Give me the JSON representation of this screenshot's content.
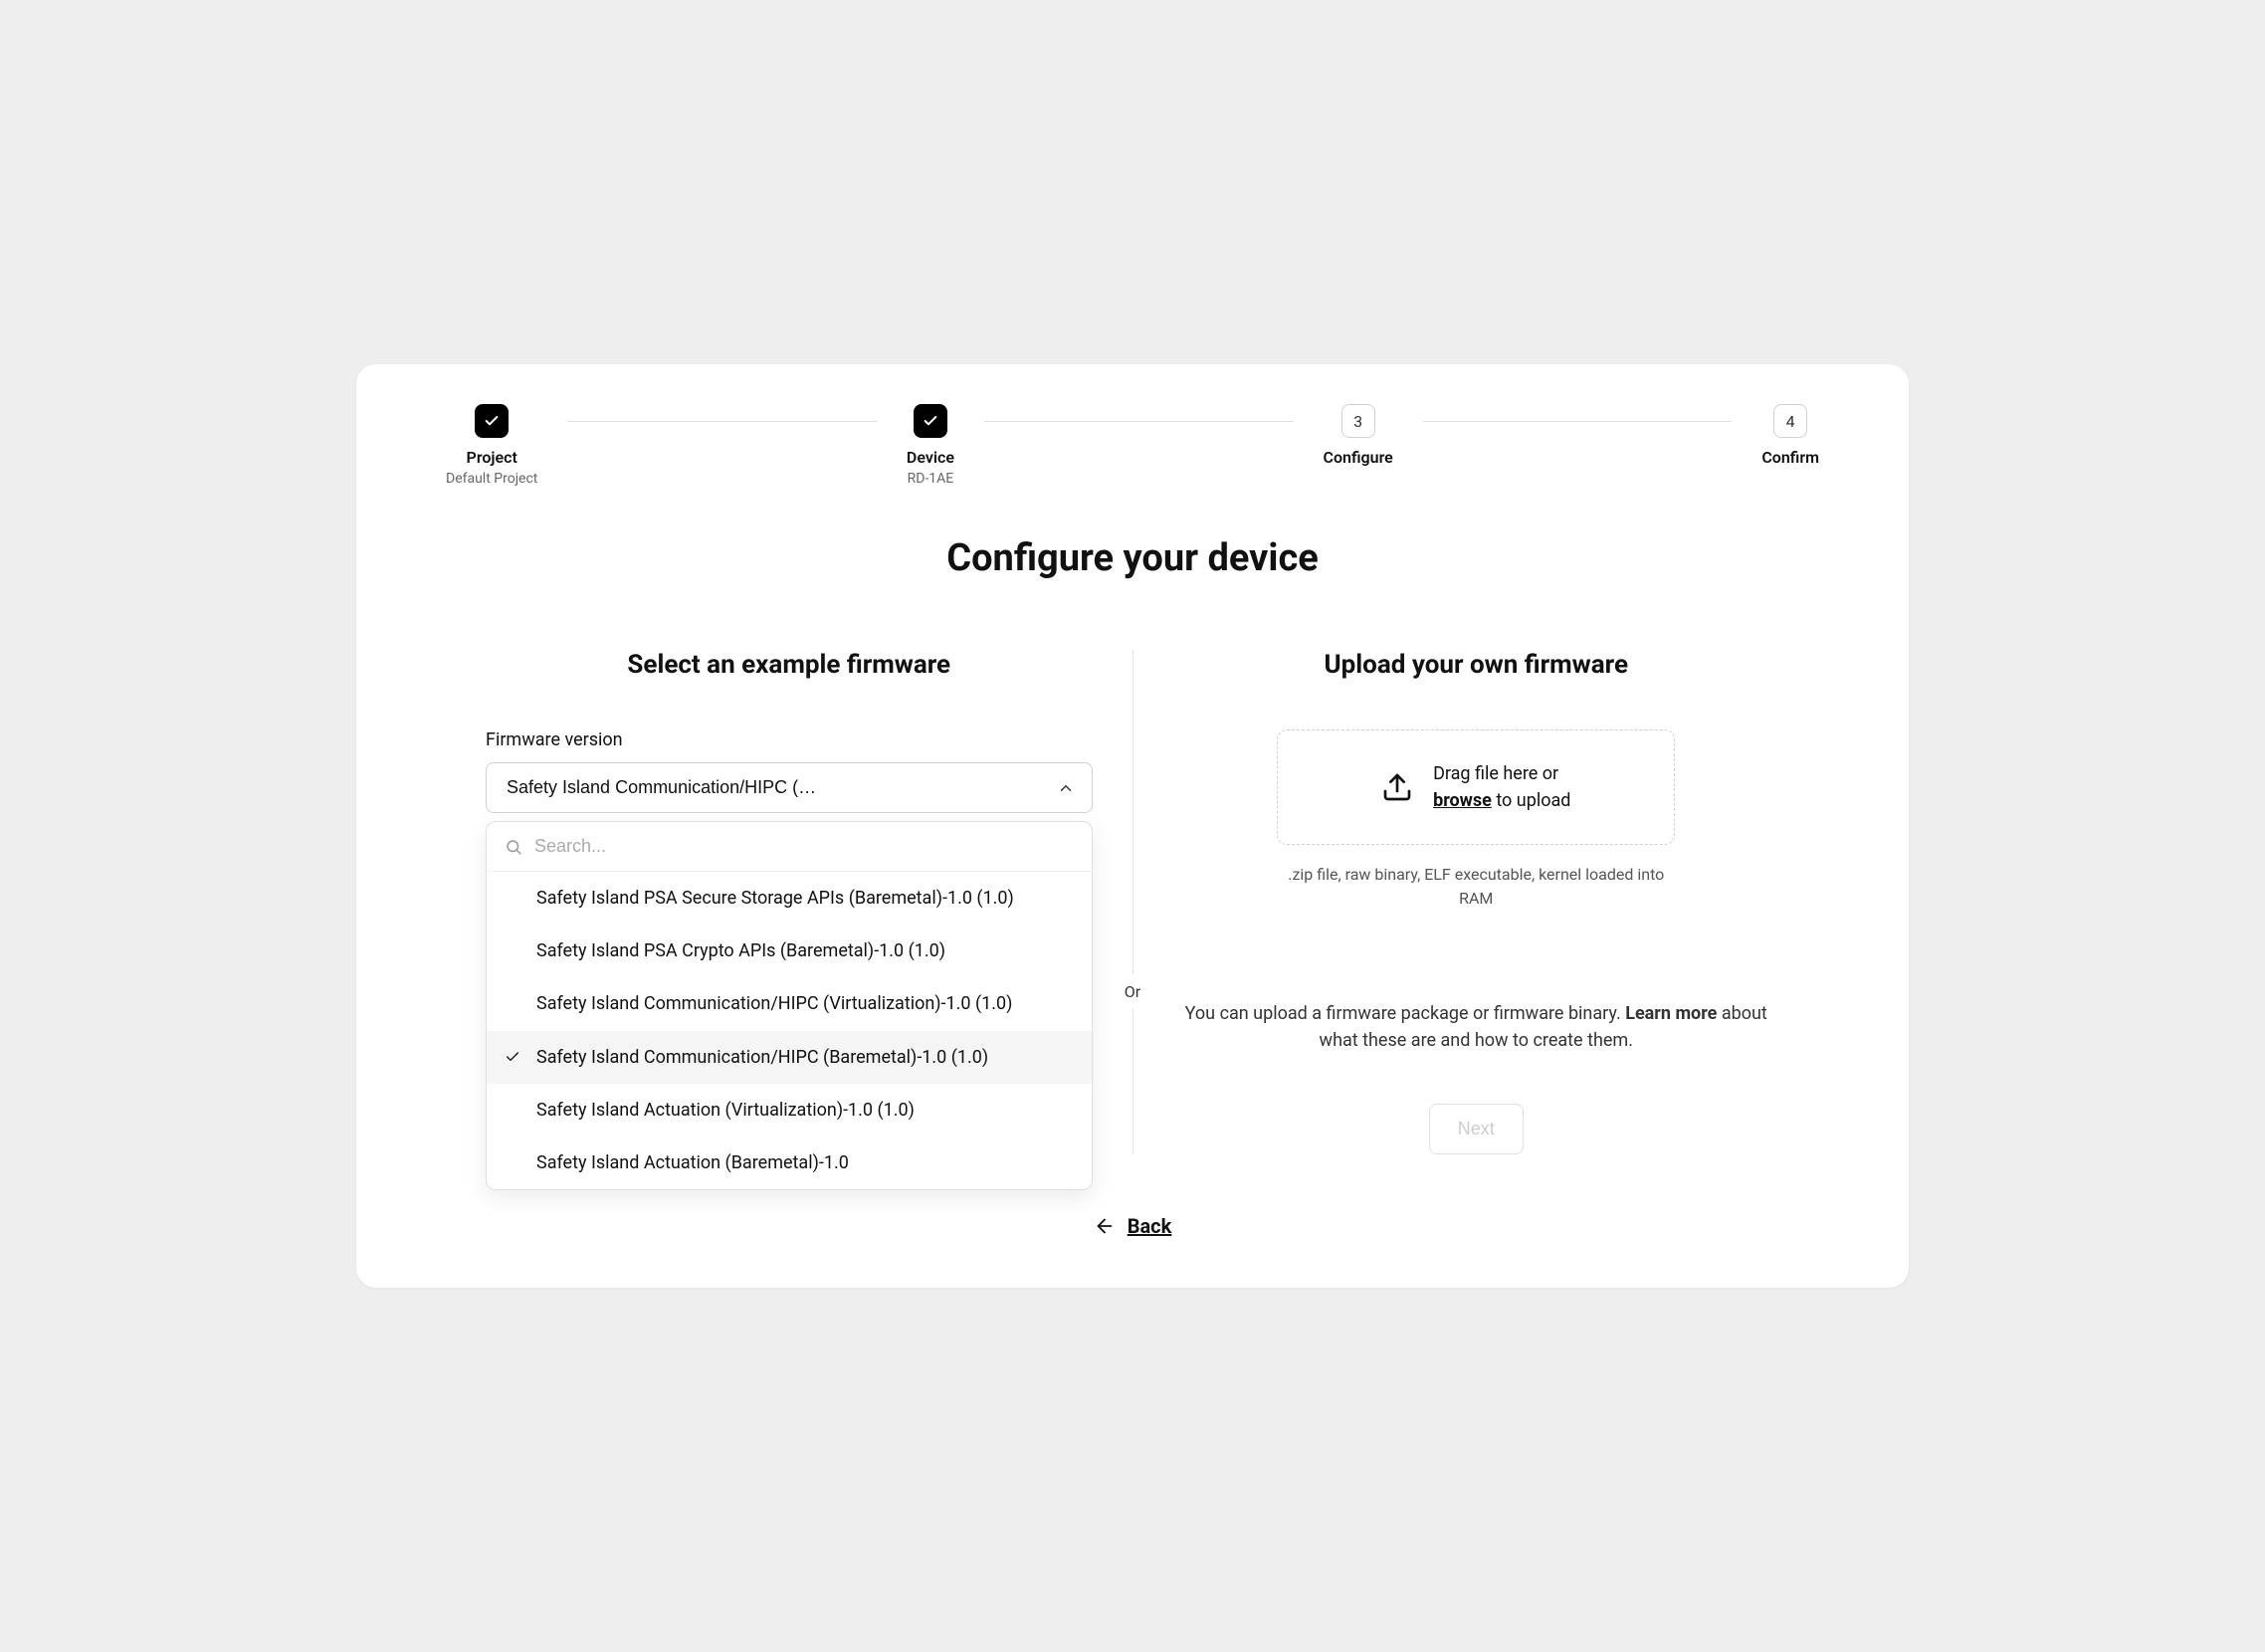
{
  "stepper": {
    "steps": [
      {
        "label": "Project",
        "sub": "Default Project",
        "state": "done"
      },
      {
        "label": "Device",
        "sub": "RD-1AE",
        "state": "done"
      },
      {
        "label": "Configure",
        "sub": "",
        "state": "current",
        "num": "3"
      },
      {
        "label": "Confirm",
        "sub": "",
        "state": "pending",
        "num": "4"
      }
    ]
  },
  "page_title": "Configure your device",
  "left": {
    "title": "Select an example firmware",
    "field_label": "Firmware version",
    "selected_display": "Safety Island Communication/HIPC (…",
    "search_placeholder": "Search...",
    "options": [
      {
        "label": "Safety Island PSA Secure Storage APIs (Baremetal)-1.0 (1.0)",
        "selected": false
      },
      {
        "label": "Safety Island PSA Crypto APIs (Baremetal)-1.0 (1.0)",
        "selected": false
      },
      {
        "label": "Safety Island Communication/HIPC (Virtualization)-1.0 (1.0)",
        "selected": false
      },
      {
        "label": "Safety Island Communication/HIPC (Baremetal)-1.0 (1.0)",
        "selected": true
      },
      {
        "label": "Safety Island Actuation (Virtualization)-1.0 (1.0)",
        "selected": false
      },
      {
        "label": "Safety Island Actuation (Baremetal)-1.0",
        "selected": false
      }
    ]
  },
  "divider_label": "Or",
  "right": {
    "title": "Upload your own firmware",
    "drop_line1": "Drag file here or",
    "browse_label": "browse",
    "drop_line2_tail": " to upload",
    "hint": ".zip file, raw binary, ELF executable, kernel loaded into RAM",
    "info_prefix": "You can upload a firmware package or firmware binary. ",
    "learn_more": "Learn more",
    "info_suffix": " about what these are and how to create them.",
    "next_label": "Next"
  },
  "back_label": "Back"
}
